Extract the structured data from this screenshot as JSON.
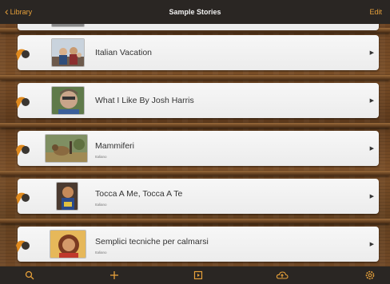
{
  "nav": {
    "back_label": "Library",
    "title": "Sample Stories",
    "edit_label": "Edit"
  },
  "stories": [
    {
      "title": "Italian Vacation",
      "subtitle": ""
    },
    {
      "title": "What I Like By Josh Harris",
      "subtitle": ""
    },
    {
      "title": "Mammiferi",
      "subtitle": "Italiano"
    },
    {
      "title": "Tocca A Me,  Tocca A Te",
      "subtitle": "Italiano"
    },
    {
      "title": "Semplici tecniche per calmarsi",
      "subtitle": "Italiano"
    }
  ],
  "toolbar": {
    "icons": [
      "search-icon",
      "add-icon",
      "import-icon",
      "cloud-upload-icon",
      "settings-icon"
    ]
  },
  "colors": {
    "accent": "#e6a03a",
    "bar": "#2a2623",
    "wood": "#6b4322",
    "card": "#f2f2f2"
  }
}
